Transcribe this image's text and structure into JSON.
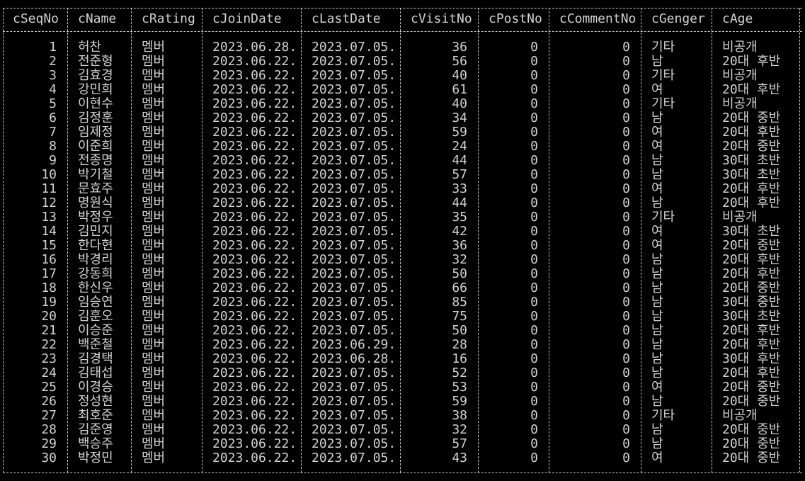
{
  "columns": [
    {
      "key": "seq",
      "label": "cSeqNo"
    },
    {
      "key": "name",
      "label": "cName"
    },
    {
      "key": "rating",
      "label": "cRating"
    },
    {
      "key": "join",
      "label": "cJoinDate"
    },
    {
      "key": "last",
      "label": "cLastDate"
    },
    {
      "key": "visit",
      "label": "cVisitNo"
    },
    {
      "key": "post",
      "label": "cPostNo"
    },
    {
      "key": "comment",
      "label": "cCommentNo"
    },
    {
      "key": "gender",
      "label": "cGenger"
    },
    {
      "key": "age",
      "label": "cAge"
    }
  ],
  "rows": [
    {
      "seq": "1",
      "name": "허찬",
      "rating": "멤버",
      "join": "2023.06.28.",
      "last": "2023.07.05.",
      "visit": "36",
      "post": "0",
      "comment": "0",
      "gender": "기타",
      "age": "비공개"
    },
    {
      "seq": "2",
      "name": "전준형",
      "rating": "멤버",
      "join": "2023.06.22.",
      "last": "2023.07.05.",
      "visit": "56",
      "post": "0",
      "comment": "0",
      "gender": "남",
      "age": "20대 후반"
    },
    {
      "seq": "3",
      "name": "김효경",
      "rating": "멤버",
      "join": "2023.06.22.",
      "last": "2023.07.05.",
      "visit": "40",
      "post": "0",
      "comment": "0",
      "gender": "기타",
      "age": "비공개"
    },
    {
      "seq": "4",
      "name": "강민희",
      "rating": "멤버",
      "join": "2023.06.22.",
      "last": "2023.07.05.",
      "visit": "61",
      "post": "0",
      "comment": "0",
      "gender": "여",
      "age": "20대 후반"
    },
    {
      "seq": "5",
      "name": "이현수",
      "rating": "멤버",
      "join": "2023.06.22.",
      "last": "2023.07.05.",
      "visit": "40",
      "post": "0",
      "comment": "0",
      "gender": "기타",
      "age": "비공개"
    },
    {
      "seq": "6",
      "name": "김정훈",
      "rating": "멤버",
      "join": "2023.06.22.",
      "last": "2023.07.05.",
      "visit": "34",
      "post": "0",
      "comment": "0",
      "gender": "남",
      "age": "20대 중반"
    },
    {
      "seq": "7",
      "name": "임제정",
      "rating": "멤버",
      "join": "2023.06.22.",
      "last": "2023.07.05.",
      "visit": "59",
      "post": "0",
      "comment": "0",
      "gender": "여",
      "age": "20대 후반"
    },
    {
      "seq": "8",
      "name": "이준희",
      "rating": "멤버",
      "join": "2023.06.22.",
      "last": "2023.07.05.",
      "visit": "24",
      "post": "0",
      "comment": "0",
      "gender": "여",
      "age": "20대 중반"
    },
    {
      "seq": "9",
      "name": "전종명",
      "rating": "멤버",
      "join": "2023.06.22.",
      "last": "2023.07.05.",
      "visit": "44",
      "post": "0",
      "comment": "0",
      "gender": "남",
      "age": "30대 초반"
    },
    {
      "seq": "10",
      "name": "박기철",
      "rating": "멤버",
      "join": "2023.06.22.",
      "last": "2023.07.05.",
      "visit": "57",
      "post": "0",
      "comment": "0",
      "gender": "남",
      "age": "30대 초반"
    },
    {
      "seq": "11",
      "name": "문효주",
      "rating": "멤버",
      "join": "2023.06.22.",
      "last": "2023.07.05.",
      "visit": "33",
      "post": "0",
      "comment": "0",
      "gender": "여",
      "age": "20대 후반"
    },
    {
      "seq": "12",
      "name": "명원식",
      "rating": "멤버",
      "join": "2023.06.22.",
      "last": "2023.07.05.",
      "visit": "44",
      "post": "0",
      "comment": "0",
      "gender": "남",
      "age": "20대 후반"
    },
    {
      "seq": "13",
      "name": "박정우",
      "rating": "멤버",
      "join": "2023.06.22.",
      "last": "2023.07.05.",
      "visit": "35",
      "post": "0",
      "comment": "0",
      "gender": "기타",
      "age": "비공개"
    },
    {
      "seq": "14",
      "name": "김민지",
      "rating": "멤버",
      "join": "2023.06.22.",
      "last": "2023.07.05.",
      "visit": "42",
      "post": "0",
      "comment": "0",
      "gender": "여",
      "age": "30대 초반"
    },
    {
      "seq": "15",
      "name": "한다현",
      "rating": "멤버",
      "join": "2023.06.22.",
      "last": "2023.07.05.",
      "visit": "36",
      "post": "0",
      "comment": "0",
      "gender": "여",
      "age": "20대 중반"
    },
    {
      "seq": "16",
      "name": "박경리",
      "rating": "멤버",
      "join": "2023.06.22.",
      "last": "2023.07.05.",
      "visit": "32",
      "post": "0",
      "comment": "0",
      "gender": "남",
      "age": "20대 후반"
    },
    {
      "seq": "17",
      "name": "강동희",
      "rating": "멤버",
      "join": "2023.06.22.",
      "last": "2023.07.05.",
      "visit": "50",
      "post": "0",
      "comment": "0",
      "gender": "남",
      "age": "20대 후반"
    },
    {
      "seq": "18",
      "name": "한신우",
      "rating": "멤버",
      "join": "2023.06.22.",
      "last": "2023.07.05.",
      "visit": "66",
      "post": "0",
      "comment": "0",
      "gender": "남",
      "age": "20대 중반"
    },
    {
      "seq": "19",
      "name": "임승연",
      "rating": "멤버",
      "join": "2023.06.22.",
      "last": "2023.07.05.",
      "visit": "85",
      "post": "0",
      "comment": "0",
      "gender": "남",
      "age": "30대 중반"
    },
    {
      "seq": "20",
      "name": "김훈오",
      "rating": "멤버",
      "join": "2023.06.22.",
      "last": "2023.07.05.",
      "visit": "75",
      "post": "0",
      "comment": "0",
      "gender": "남",
      "age": "30대 초반"
    },
    {
      "seq": "21",
      "name": "이승준",
      "rating": "멤버",
      "join": "2023.06.22.",
      "last": "2023.07.05.",
      "visit": "50",
      "post": "0",
      "comment": "0",
      "gender": "남",
      "age": "20대 후반"
    },
    {
      "seq": "22",
      "name": "백준철",
      "rating": "멤버",
      "join": "2023.06.22.",
      "last": "2023.06.29.",
      "visit": "28",
      "post": "0",
      "comment": "0",
      "gender": "남",
      "age": "20대 후반"
    },
    {
      "seq": "23",
      "name": "김경택",
      "rating": "멤버",
      "join": "2023.06.22.",
      "last": "2023.06.28.",
      "visit": "16",
      "post": "0",
      "comment": "0",
      "gender": "남",
      "age": "30대 후반"
    },
    {
      "seq": "24",
      "name": "김태섭",
      "rating": "멤버",
      "join": "2023.06.22.",
      "last": "2023.07.05.",
      "visit": "52",
      "post": "0",
      "comment": "0",
      "gender": "남",
      "age": "20대 후반"
    },
    {
      "seq": "25",
      "name": "이경승",
      "rating": "멤버",
      "join": "2023.06.22.",
      "last": "2023.07.05.",
      "visit": "53",
      "post": "0",
      "comment": "0",
      "gender": "여",
      "age": "20대 중반"
    },
    {
      "seq": "26",
      "name": "정성현",
      "rating": "멤버",
      "join": "2023.06.22.",
      "last": "2023.07.05.",
      "visit": "59",
      "post": "0",
      "comment": "0",
      "gender": "남",
      "age": "20대 중반"
    },
    {
      "seq": "27",
      "name": "최호준",
      "rating": "멤버",
      "join": "2023.06.22.",
      "last": "2023.07.05.",
      "visit": "38",
      "post": "0",
      "comment": "0",
      "gender": "기타",
      "age": "비공개"
    },
    {
      "seq": "28",
      "name": "김준영",
      "rating": "멤버",
      "join": "2023.06.22.",
      "last": "2023.07.05.",
      "visit": "32",
      "post": "0",
      "comment": "0",
      "gender": "남",
      "age": "20대 중반"
    },
    {
      "seq": "29",
      "name": "백승주",
      "rating": "멤버",
      "join": "2023.06.22.",
      "last": "2023.07.05.",
      "visit": "57",
      "post": "0",
      "comment": "0",
      "gender": "남",
      "age": "20대 중반"
    },
    {
      "seq": "30",
      "name": "박정민",
      "rating": "멤버",
      "join": "2023.06.22.",
      "last": "2023.07.05.",
      "visit": "43",
      "post": "0",
      "comment": "0",
      "gender": "여",
      "age": "20대 중반"
    }
  ],
  "colors": {
    "background": "#000000",
    "text": "#d2d2d2",
    "border": "#c8c8c8"
  }
}
